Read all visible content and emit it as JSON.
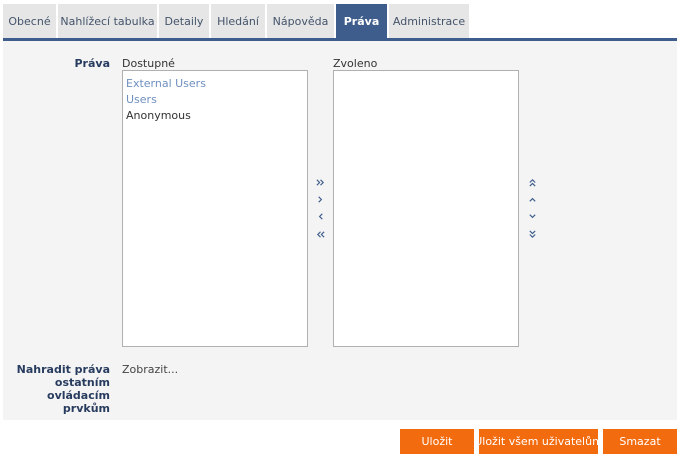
{
  "tabs": [
    {
      "label": "Obecné"
    },
    {
      "label": "Nahlížecí tabulka"
    },
    {
      "label": "Detaily"
    },
    {
      "label": "Hledání"
    },
    {
      "label": "Nápověda"
    },
    {
      "label": "Práva",
      "active": true
    },
    {
      "label": "Administrace"
    }
  ],
  "rights": {
    "label": "Práva",
    "available_caption": "Dostupné",
    "available_items": [
      "External Users",
      "Users",
      "Anonymous"
    ],
    "selected_caption": "Zvoleno",
    "selected_items": []
  },
  "move_buttons": {
    "add_all": "»",
    "add": "›",
    "remove": "‹",
    "remove_all": "«",
    "move_top": "⇑",
    "move_up": "∧",
    "move_down": "∨",
    "move_bottom": "⇓"
  },
  "replace": {
    "label_line1": "Nahradit práva",
    "label_line2": "ostatním",
    "label_line3": "ovládacím",
    "label_line4": "prvkům",
    "link": "Zobrazit..."
  },
  "buttons": {
    "save": "Uložit",
    "save_all": "Uložit všem uživatelům",
    "delete": "Smazat"
  },
  "colors": {
    "accent": "#3e5d8c",
    "button": "#f36b0f",
    "tab_bg": "#e6e6e6",
    "form_bg": "#f4f4f4"
  }
}
